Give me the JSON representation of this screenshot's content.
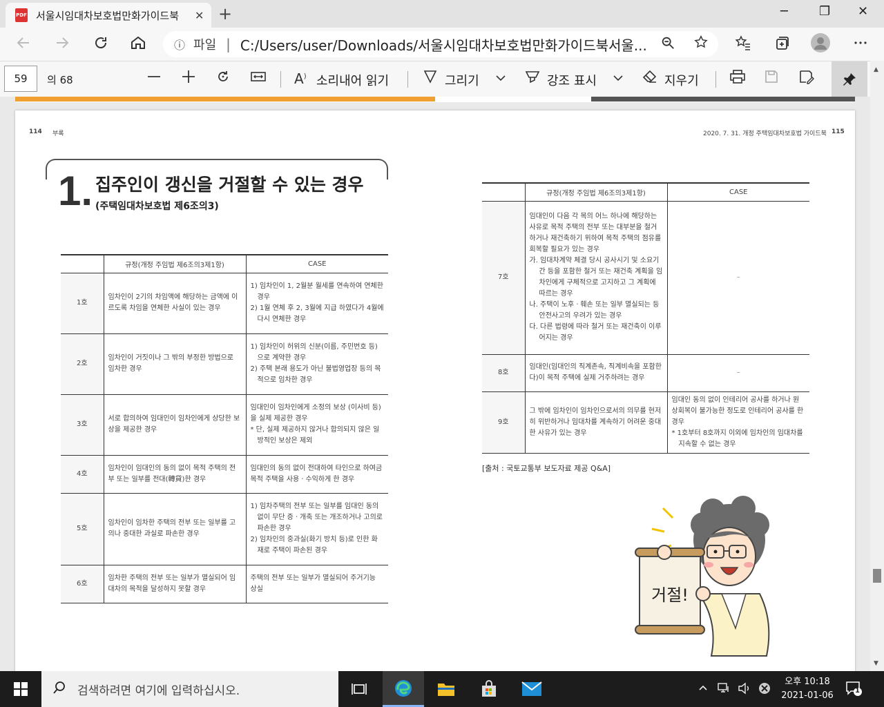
{
  "browser": {
    "tab_title": "서울시임대차보호법만화가이드북",
    "tab_close": "✕",
    "new_tab": "+",
    "pdf_badge": "PDF",
    "info_icon": "ⓘ",
    "file_label": "파일",
    "separator": "|",
    "url": "C:/Users/user/Downloads/서울시임대차보호법만화가이드북서울...",
    "window_controls": [
      "─",
      "❐",
      "✕"
    ]
  },
  "pdf_toolbar": {
    "page_number": "59",
    "page_total": "의 68",
    "read_aloud": "소리내어 읽기",
    "draw": "그리기",
    "highlight": "강조 표시",
    "erase": "지우기"
  },
  "document": {
    "left_page_num": "114",
    "left_section": "부록",
    "right_header": "2020. 7. 31. 개정 주택임대차보호법 가이드북",
    "right_page_num": "115",
    "section_number": "1.",
    "section_title": "집주인이 갱신을 거절할 수 있는 경우",
    "section_subtitle": "(주택임대차보호법 제6조의3)",
    "left_table": {
      "headers": [
        "",
        "규정(개정 주임법 제6조의3제1항)",
        "CASE"
      ],
      "rows": [
        {
          "no": "1호",
          "rule": "임차인이 2기의 차임액에 해당하는 금액에 이르도록 차임을 연체한 사실이 있는 경우",
          "cases": [
            "1) 임차인이 1, 2월분 월세를 연속하여 연체한 경우",
            "2) 1월 연체 후 2, 3월에 지급 하였다가 4월에 다시 연체한 경우"
          ]
        },
        {
          "no": "2호",
          "rule": "임차인이 거짓이나 그 밖의 부정한 방법으로 임차한 경우",
          "cases": [
            "1) 임차인이 허위의 신분(이름, 주민번호 등)으로 계약한 경우",
            "2) 주택 본래 용도가 아닌 불법영업장 등의 목적으로 임차한 경우"
          ]
        },
        {
          "no": "3호",
          "rule": "서로 합의하여 임대인이 임차인에게 상당한 보상을 제공한 경우",
          "cases": [
            "임대인이 임차인에게 소정의 보상 (이사비 등)을 실제 제공한 경우",
            "* 단, 실제 제공하지 않거나 합의되지 않은 일방적인 보상은 제외"
          ]
        },
        {
          "no": "4호",
          "rule": "임차인이 임대인의 동의 없이 목적 주택의 전부 또는 일부를 전대(轉貸)한 경우",
          "cases": [
            "임대인의 동의 없이 전대하여 타인으로 하여금 목적 주택을 사용ㆍ수익하게 한 경우"
          ]
        },
        {
          "no": "5호",
          "rule": "임차인이 임차한 주택의 전부 또는 일부를 고의나 중대한 과실로 파손한 경우",
          "cases": [
            "1) 임차주택의 전부 또는 일부를 임대인 동의없이 무단 증ㆍ개축 또는 개조하거나 고의로 파손한 경우",
            "2) 임차인의 중과실(화기 방치 등)로 인한 화재로 주택이 파손된 경우"
          ]
        },
        {
          "no": "6호",
          "rule": "임차한 주택의 전부 또는 일부가 멸실되어 임대차의 목적을 달성하지 못할 경우",
          "cases": [
            "주택의 전부 또는 일부가 멸실되어 주거기능 상실"
          ]
        }
      ]
    },
    "right_table": {
      "headers": [
        "",
        "규정(개정 주임법 제6조의3제1항)",
        "CASE"
      ],
      "rows": [
        {
          "no": "7호",
          "rule_lines": [
            "임대인이 다음 각 목의 어느 하나에 해당하는 사유로 목적 주택의 전부 또는 대부분을 철거하거나 재건축하기 위하여 목적 주택의 점유를 회복할 필요가 있는 경우",
            "가. 임대차계약 체결 당시 공사시기 및 소요기간 등을 포함한 철거 또는 재건축 계획을 임차인에게 구체적으로 고지하고 그 계획에 따르는 경우",
            "나. 주택이 노후ㆍ훼손 또는 일부 멸실되는 등 안전사고의 우려가 있는 경우",
            "다. 다른 법령에 따라 철거 또는 재건축이 이루어지는 경우"
          ],
          "cases": [
            "–"
          ]
        },
        {
          "no": "8호",
          "rule_lines": [
            "임대인(임대인의 직계존속, 직계비속을 포함한다)이 목적 주택에 실제 거주하려는 경우"
          ],
          "cases": [
            "–"
          ]
        },
        {
          "no": "9호",
          "rule_lines": [
            "그 밖에 임차인이 임차인으로서의 의무를 현저히 위반하거나 임대차를 계속하기 어려운 중대한 사유가 있는 경우"
          ],
          "cases": [
            "임대인 동의 없이 인테리어 공사를 하거나 원상회복이 불가능한 정도로 인테리어 공사를 한 경우",
            "* 1호부터 8호까지 이외에 임차인의 임대차를 지속할 수 없는 경우"
          ]
        }
      ]
    },
    "source": "[출처 : 국토교통부 보도자료 제공 Q&A]",
    "sign_text": "거절!"
  },
  "taskbar": {
    "search_placeholder": "검색하려면 여기에 입력하십시오.",
    "time": "오후 10:18",
    "date": "2021-01-06",
    "notification_count": "1"
  },
  "colors": {
    "accent_orange": "#f0a030",
    "taskbar": "#1c1c1c"
  }
}
